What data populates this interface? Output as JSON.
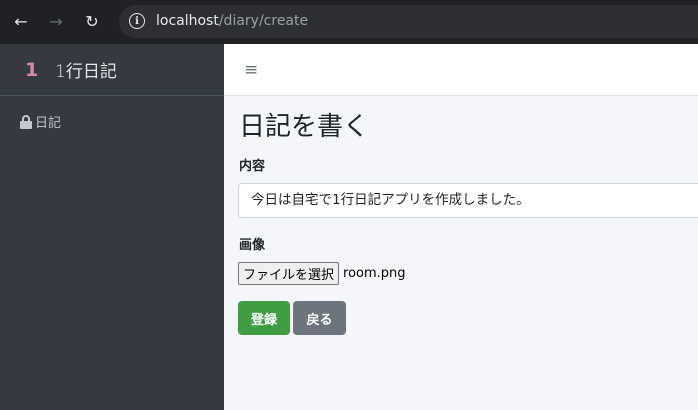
{
  "browser": {
    "back_icon": "←",
    "forward_icon": "→",
    "reload_icon": "↻",
    "info_icon": "i",
    "url_host": "localhost",
    "url_path": "/diary/create"
  },
  "sidebar": {
    "brand_logo": "1",
    "brand_text": "1行日記",
    "items": [
      {
        "icon": "lock-icon",
        "label": "日記"
      }
    ]
  },
  "navbar": {
    "menu_icon": "≡"
  },
  "main": {
    "title": "日記を書く",
    "content_label": "内容",
    "content_value": "今日は自宅で1行日記アプリを作成しました。",
    "image_label": "画像",
    "file_button_label": "ファイルを選択",
    "file_name": "room.png",
    "submit_label": "登録",
    "back_label": "戻る"
  },
  "colors": {
    "sidebar_bg": "#343a40",
    "submit_bg": "#3f9e43",
    "back_bg": "#6c757d",
    "brand_logo": "#d98aa6"
  }
}
